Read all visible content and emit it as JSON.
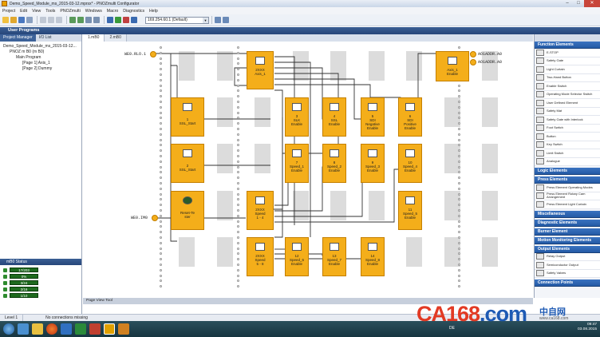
{
  "window": {
    "title": "Demo_Speed_Module_ms_2015-03-12.mprsx* - PNOZmulti Configurator",
    "controls": [
      "–",
      "□",
      "✕"
    ]
  },
  "menu": [
    "Project",
    "Edit",
    "View",
    "Tools",
    "PNOZmulti",
    "Windows",
    "Macro",
    "Diagnostics",
    "Help"
  ],
  "toolbar": {
    "address": "169.254.60.1 (Default)"
  },
  "section_title": "User Programs",
  "left": {
    "tabs": [
      "Project Manager",
      "I/O List"
    ],
    "tree": [
      "Demo_Speed_Module_ms_2015-03-12...",
      "PNOZ m B0 (m B0)",
      "Main Program",
      "[Page 1] Axis_1",
      "[Page 2] Dummy"
    ],
    "status_title": "mB0 Status",
    "status_rows": [
      "17/203",
      "0%",
      "3/24",
      "2/16",
      "1/10"
    ]
  },
  "doc_tabs": [
    "1.mB0",
    "2.mB0"
  ],
  "canvas": {
    "inputs": [
      "WE0.RLO.1",
      "WE0.IM0"
    ],
    "outputs": [
      "AO1ADDR.A0",
      "AO1ADDR.A0"
    ],
    "blocks": [
      {
        "id": "axis",
        "label": "2XXX\nAxis_1"
      },
      {
        "id": "axis_en",
        "label": "Axis_1\nEnable"
      },
      {
        "id": "ssl1",
        "label": "1\nSSL_Start"
      },
      {
        "id": "ssl2",
        "label": "2\nSSL_Start"
      },
      {
        "id": "reset",
        "label": "Reset-Te\nster"
      },
      {
        "id": "b3",
        "label": "3\nSLK\nEnable"
      },
      {
        "id": "b4",
        "label": "4\nSSL\nEnable"
      },
      {
        "id": "b5",
        "label": "5\nSDI\nNegative\nEnable"
      },
      {
        "id": "b6",
        "label": "6\nSDI\nPositive\nEnable"
      },
      {
        "id": "b7",
        "label": "7\nSpeed_1\nEnable"
      },
      {
        "id": "b8",
        "label": "8\nSpeed_2\nEnable"
      },
      {
        "id": "b9",
        "label": "9\nSpeed_3\nEnable"
      },
      {
        "id": "b10",
        "label": "10\nSpeed_4\nEnable"
      },
      {
        "id": "spd14",
        "label": "2XXX\nSpeed\n1 - 4"
      },
      {
        "id": "b11",
        "label": "11\nSpeed_5\nEnable"
      },
      {
        "id": "spd58",
        "label": "2XXX\nSpeed\n5 - 8"
      },
      {
        "id": "b12",
        "label": "12\nSpeed_6\nEnable"
      },
      {
        "id": "b13",
        "label": "13\nSpeed_7\nEnable"
      },
      {
        "id": "b14",
        "label": "14\nSpeed_8\nEnable"
      }
    ]
  },
  "page_view": "Page View Tool",
  "right": {
    "sections": [
      "Function Elements",
      "Logic Elements",
      "Press Elements",
      "Miscellaneous",
      "Diagnostic Elements",
      "Burner Element",
      "Motion Monitoring Elements",
      "Output Elements",
      "Connection Points"
    ],
    "function_items": [
      "E-STOP",
      "Safety Gate",
      "Light Curtain",
      "Two-Hand Button",
      "Enable Switch",
      "Operating Mode Selector Switch",
      "User Defined Element",
      "Safety Mat",
      "Safety Gate with Interlock",
      "Foot Switch",
      "Button",
      "Key Switch",
      "Limit Switch",
      "Analogue"
    ],
    "press_items": [
      "Press Element Operating Modes",
      "Press Element Rotary Cam Arrangement",
      "Press Element Light Curtain"
    ],
    "output_items": [
      "Relay Output",
      "Semiconductor Output",
      "Safety Valves"
    ]
  },
  "statusbar": {
    "level": "Level 1",
    "message": "No connections missing"
  },
  "clock": {
    "time": "09:47",
    "date": "03.08.2015",
    "lang": "DE"
  },
  "watermark": {
    "brand": "CA168",
    "suffix": ".com",
    "cn": "中自网",
    "url": "www.ca168.com"
  },
  "colors": {
    "block": "#f4ae1a",
    "header": "#27467a",
    "wire": "#333333"
  }
}
